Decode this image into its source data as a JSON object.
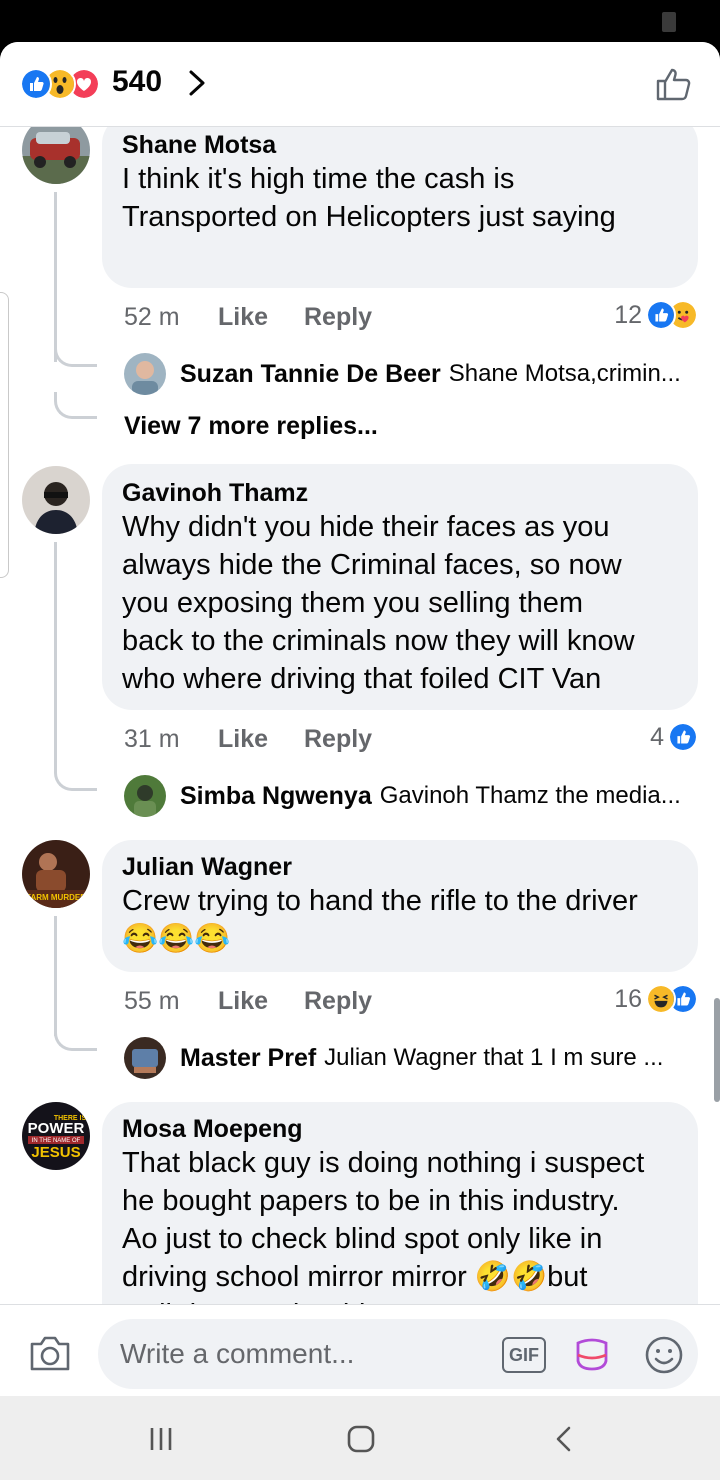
{
  "header": {
    "reaction_count": "540",
    "reactions": [
      "like",
      "wow",
      "love"
    ]
  },
  "comments": [
    {
      "name": "Shane Motsa",
      "text": "I think it's high time the cash is\nTransported on Helicopters just saying",
      "time": "52 m",
      "like_label": "Like",
      "reply_label": "Reply",
      "reaction_count": "12",
      "reactions": [
        "like",
        "care"
      ],
      "reply_preview": {
        "name": "Suzan Tannie De Beer",
        "text": "Shane Motsa,crimin..."
      },
      "more_replies": "View 7 more replies..."
    },
    {
      "name": "Gavinoh Thamz",
      "text": "Why didn't you hide their faces as you\nalways hide the Criminal faces, so now\nyou exposing them you selling them\nback to the criminals now they will know\nwho where driving that foiled CIT Van",
      "time": "31 m",
      "like_label": "Like",
      "reply_label": "Reply",
      "reaction_count": "4",
      "reactions": [
        "like"
      ],
      "reply_preview": {
        "name": "Simba Ngwenya",
        "text": "Gavinoh Thamz the media..."
      }
    },
    {
      "name": "Julian Wagner",
      "text": "Crew trying to hand the rifle to the driver",
      "emoji_line": "😂😂😂",
      "time": "55 m",
      "like_label": "Like",
      "reply_label": "Reply",
      "reaction_count": "16",
      "reactions": [
        "haha",
        "like"
      ],
      "reply_preview": {
        "name": "Master Pref",
        "text": "Julian Wagner that 1 I m sure ..."
      }
    },
    {
      "name": "Mosa Moepeng",
      "text": "That black guy is doing nothing i suspect\nhe bought papers to be in this industry.\nAo just to check blind spot only like in\ndriving school mirror mirror 🤣🤣but\nwell done to the driver",
      "avatar_text": [
        "THERE IS",
        "POWER",
        "IN THE NAME OF",
        "JESUS"
      ]
    }
  ],
  "avatar_labels": {
    "julian": "FARM MURDER"
  },
  "composer": {
    "placeholder": "Write a comment...",
    "gif_label": "GIF"
  },
  "colors": {
    "like_blue": "#1877f2",
    "love_red": "#f33e58",
    "wow_yellow": "#f7b928",
    "bubble_bg": "#f0f2f5",
    "secondary_text": "#65676b"
  }
}
